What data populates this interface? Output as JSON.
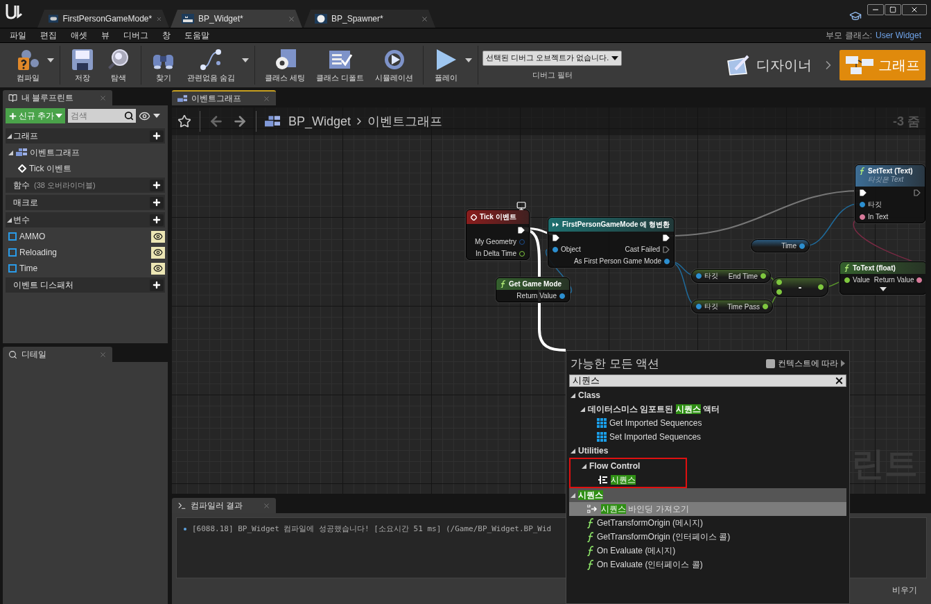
{
  "title_bar": {
    "tabs": [
      {
        "label": "FirstPersonGameMode*",
        "kind": "gamemode",
        "selected": false
      },
      {
        "label": "BP_Widget*",
        "kind": "widget",
        "selected": true
      },
      {
        "label": "BP_Spawner*",
        "kind": "sphere",
        "selected": false
      }
    ]
  },
  "menu": [
    "파일",
    "편집",
    "애셋",
    "뷰",
    "디버그",
    "창",
    "도움말"
  ],
  "parent_class": {
    "label": "부모 클래스:",
    "value": "User Widget"
  },
  "toolbar": {
    "groups": [
      [
        {
          "label": "컴파일",
          "kind": "compile",
          "dropdown": true
        }
      ],
      [
        {
          "label": "저장",
          "kind": "save",
          "dropdown": false
        },
        {
          "label": "탐색",
          "kind": "browse",
          "dropdown": false
        }
      ],
      [
        {
          "label": "찾기",
          "kind": "find",
          "dropdown": false
        },
        {
          "label": "관련없음 숨김",
          "kind": "hide",
          "dropdown": true
        }
      ],
      [
        {
          "label": "클래스 세팅",
          "kind": "settings",
          "dropdown": false
        },
        {
          "label": "클래스 디폴트",
          "kind": "defaults",
          "dropdown": false
        },
        {
          "label": "시뮬레이션",
          "kind": "simulate",
          "dropdown": false
        }
      ],
      [
        {
          "label": "플레이",
          "kind": "play",
          "dropdown": true
        }
      ]
    ],
    "debug_filter": {
      "value": "선택된 디버그 오브젝트가 없습니다.",
      "label": "디버그 필터"
    },
    "modes": [
      {
        "label": "디자이너",
        "kind": "designer",
        "selected": false
      },
      {
        "label": "그래프",
        "kind": "graph",
        "selected": true
      }
    ]
  },
  "my_blueprint": {
    "tab": "내 블루프린트",
    "add_button": "신규 추가",
    "search": {
      "placeholder": "검색"
    },
    "sections": [
      {
        "title": "그래프",
        "expanded": true,
        "items": [
          {
            "label": "이벤트그래프",
            "kind": "graph",
            "expanded": true,
            "children": [
              {
                "label": "Tick 이벤트",
                "kind": "event"
              }
            ]
          }
        ]
      },
      {
        "title": "함수",
        "note": "(38 오버라이더블)",
        "expanded": false
      },
      {
        "title": "매크로",
        "expanded": false
      },
      {
        "title": "변수",
        "expanded": true,
        "items": [
          {
            "label": "AMMO",
            "kind": "variable",
            "exposed": true
          },
          {
            "label": "Reloading",
            "kind": "variable",
            "exposed": true
          },
          {
            "label": "Time",
            "kind": "variable",
            "exposed": true
          }
        ]
      },
      {
        "title": "이벤트 디스패처",
        "expanded": false
      }
    ]
  },
  "details": {
    "tab": "디테일"
  },
  "graph": {
    "tab": "이벤트그래프",
    "breadcrumb": [
      "BP_Widget",
      "이벤트그래프"
    ],
    "zoom": "-3 줌",
    "watermark": "린트",
    "nodes": [
      {
        "kind": "event",
        "title": "Tick 이벤트",
        "rows": [
          {
            "out": {
              "kind": "exec",
              "linked": true
            }
          },
          {
            "out": {
              "label": "My Geometry",
              "kind": "struct",
              "linked": false
            }
          },
          {
            "out": {
              "label": "In Delta Time",
              "kind": "float",
              "linked": false
            }
          }
        ]
      },
      {
        "kind": "cast",
        "title": "FirstPersonGameMode 에 형변환",
        "rows": [
          {
            "in": {
              "kind": "exec",
              "linked": true
            },
            "out": {
              "kind": "exec",
              "linked": true
            }
          },
          {
            "in": {
              "label": "Object",
              "kind": "object",
              "linked": true
            },
            "out": {
              "label": "Cast Failed",
              "kind": "exec",
              "linked": false
            }
          },
          {
            "out": {
              "label": "As First Person Game Mode",
              "kind": "object",
              "linked": true
            }
          }
        ]
      },
      {
        "kind": "function",
        "title": "Get Game Mode",
        "rows": [
          {
            "out": {
              "label": "Return Value",
              "kind": "object",
              "linked": true
            }
          }
        ]
      },
      {
        "kind": "variable",
        "rows": [
          {
            "out": {
              "label": "Time",
              "kind": "object",
              "linked": true
            }
          }
        ]
      },
      {
        "kind": "getter",
        "rows": [
          {
            "in": {
              "label": "타깃",
              "kind": "object",
              "linked": true
            },
            "out": {
              "label": "End Time",
              "kind": "float",
              "linked": true
            }
          }
        ]
      },
      {
        "kind": "getter",
        "rows": [
          {
            "in": {
              "label": "타깃",
              "kind": "object",
              "linked": true
            },
            "out": {
              "label": "Time Pass",
              "kind": "float",
              "linked": true
            }
          }
        ]
      },
      {
        "kind": "operator",
        "title": "-",
        "rows": [
          {
            "in": {
              "kind": "float",
              "linked": true
            },
            "out": {
              "kind": "float",
              "linked": true
            }
          },
          {
            "in": {
              "kind": "float",
              "linked": true
            }
          }
        ]
      },
      {
        "kind": "target_function",
        "title": "SetText (Text)",
        "subtitle": "타깃은 Text",
        "rows": [
          {
            "in": {
              "kind": "exec",
              "linked": true
            },
            "out": {
              "kind": "exec",
              "linked": false
            }
          },
          {
            "in": {
              "label": "타깃",
              "kind": "object",
              "linked": true
            }
          },
          {
            "in": {
              "label": "In Text",
              "kind": "text",
              "linked": true
            }
          }
        ]
      },
      {
        "kind": "function",
        "title": "ToText (float)",
        "expandable": true,
        "rows": [
          {
            "in": {
              "label": "Value",
              "kind": "float",
              "linked": true
            },
            "out": {
              "label": "Return Value",
              "kind": "text",
              "linked": true
            }
          }
        ]
      }
    ]
  },
  "compiler": {
    "tab": "컴파일러 결과",
    "messages": [
      "[6088.18] BP_Widget 컴파일에 성공했습니다! [소요시간 51 ms] (/Game/BP_Widget.BP_Wid"
    ],
    "clear_button": "비우기"
  },
  "action_menu": {
    "title": "가능한 모든 액션",
    "context_toggle": {
      "label": "컨텍스트에 따라",
      "checked": false
    },
    "search": {
      "value": "시퀀스"
    },
    "tree": [
      {
        "parts": [
          {
            "text": "Class",
            "match": false
          }
        ],
        "expanded": true,
        "children": [
          {
            "parts": [
              {
                "text": "데이터스미스 임포트된 ",
                "match": false
              },
              {
                "text": "시퀀스",
                "match": true
              },
              {
                "text": " 액터",
                "match": false
              }
            ],
            "expanded": true,
            "children": [
              {
                "kind": "grid",
                "parts": [
                  {
                    "text": "Get Imported Sequences",
                    "match": false
                  }
                ],
                "selected": false
              },
              {
                "kind": "grid",
                "parts": [
                  {
                    "text": "Set Imported Sequences",
                    "match": false
                  }
                ],
                "selected": false
              }
            ]
          }
        ]
      },
      {
        "parts": [
          {
            "text": "Utilities",
            "match": false
          }
        ],
        "expanded": true,
        "children": [
          {
            "parts": [
              {
                "text": "Flow Control",
                "match": false
              }
            ],
            "expanded": true,
            "annotated": true,
            "children": [
              {
                "kind": "sequence",
                "parts": [
                  {
                    "text": "시퀀스",
                    "match": true
                  }
                ],
                "selected": false
              }
            ]
          }
        ]
      },
      {
        "parts": [
          {
            "text": "시퀀스",
            "match": true
          }
        ],
        "expanded": true,
        "children": [
          {
            "kind": "binding",
            "parts": [
              {
                "text": "시퀀스",
                "match": true
              },
              {
                "text": " 바인딩 가져오기",
                "match": false
              }
            ],
            "selected": true
          },
          {
            "kind": "function",
            "parts": [
              {
                "text": "GetTransformOrigin (메시지)",
                "match": false
              }
            ],
            "selected": false
          },
          {
            "kind": "function",
            "parts": [
              {
                "text": "GetTransformOrigin (인터페이스 콜)",
                "match": false
              }
            ],
            "selected": false
          },
          {
            "kind": "function",
            "parts": [
              {
                "text": "On Evaluate (메시지)",
                "match": false
              }
            ],
            "selected": false
          },
          {
            "kind": "function",
            "parts": [
              {
                "text": "On Evaluate (인터페이스 콜)",
                "match": false
              }
            ],
            "selected": false
          }
        ]
      }
    ]
  }
}
